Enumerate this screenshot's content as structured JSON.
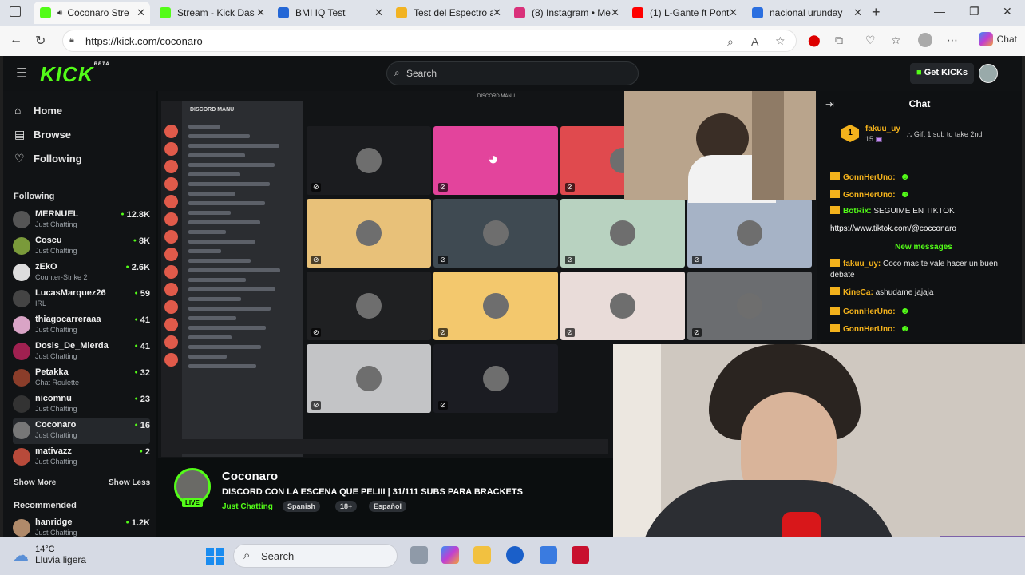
{
  "browser": {
    "tabs": [
      {
        "title": "Coconaro Stre",
        "icon": "kick-icon",
        "color": "#53fc18",
        "active": true
      },
      {
        "title": "Stream - Kick Das",
        "icon": "kick-icon",
        "color": "#53fc18"
      },
      {
        "title": "BMI IQ Test",
        "icon": "iq-icon",
        "color": "#2467d6"
      },
      {
        "title": "Test del Espectro a",
        "icon": "spectrum-icon",
        "color": "#f2b322"
      },
      {
        "title": "(8) Instagram • Me",
        "icon": "instagram-icon",
        "color": "#d9317a"
      },
      {
        "title": "(1) L-Gante ft Pont",
        "icon": "youtube-icon",
        "color": "#ff0000"
      },
      {
        "title": "nacional urunday",
        "icon": "search-icon",
        "color": "#2b6fe0"
      }
    ],
    "url": "https://kick.com/coconaro",
    "chat_label": "Chat"
  },
  "kick": {
    "logo": "KICK",
    "logo_sup": "BETA",
    "search_placeholder": "Search",
    "get_kicks": "Get KICKs",
    "nav": [
      {
        "label": "Home",
        "icon": "home-icon"
      },
      {
        "label": "Browse",
        "icon": "browse-icon"
      },
      {
        "label": "Following",
        "icon": "heart-icon"
      }
    ],
    "following_heading": "Following",
    "following": [
      {
        "name": "MERNUEL",
        "category": "Just Chatting",
        "viewers": "12.8K",
        "color": "#555"
      },
      {
        "name": "Coscu",
        "category": "Just Chatting",
        "viewers": "8K",
        "color": "#7a9a3a"
      },
      {
        "name": "zEkO",
        "category": "Counter-Strike 2",
        "viewers": "2.6K",
        "color": "#ddd"
      },
      {
        "name": "LucasMarquez26",
        "category": "IRL",
        "viewers": "59",
        "color": "#444"
      },
      {
        "name": "thiagocarreraaa",
        "category": "Just Chatting",
        "viewers": "41",
        "color": "#d9a4c6"
      },
      {
        "name": "Dosis_De_Mierda",
        "category": "Just Chatting",
        "viewers": "41",
        "color": "#a02050"
      },
      {
        "name": "Petakka",
        "category": "Chat Roulette",
        "viewers": "32",
        "color": "#8a3d2a"
      },
      {
        "name": "nicomnu",
        "category": "Just Chatting",
        "viewers": "23",
        "color": "#333"
      },
      {
        "name": "Coconaro",
        "category": "Just Chatting",
        "viewers": "16",
        "color": "#777",
        "selected": true
      },
      {
        "name": "mativazz",
        "category": "Just Chatting",
        "viewers": "2",
        "color": "#b84a3a"
      }
    ],
    "show_more": "Show More",
    "show_less": "Show Less",
    "recommended_heading": "Recommended",
    "recommended": [
      {
        "name": "hanridge",
        "category": "Just Chatting",
        "viewers": "1.2K",
        "color": "#b08a6a"
      }
    ]
  },
  "stream": {
    "discord_title": "DISCORD MANU",
    "discord_header": "DISCORD MANU",
    "tiles": [
      {
        "bg": "#1b1c1f"
      },
      {
        "bg": "#e3449c",
        "discord": true
      },
      {
        "bg": "#e04a4e"
      },
      {
        "bg": "#e8c179"
      },
      {
        "bg": "#3f4a52"
      },
      {
        "bg": "#b8d2c0"
      },
      {
        "bg": "#a6b3c6"
      },
      {
        "bg": "#1f2022"
      },
      {
        "bg": "#f3c86d"
      },
      {
        "bg": "#e9dcd9"
      },
      {
        "bg": "#6b6d70"
      },
      {
        "bg": "#c3c4c6"
      },
      {
        "bg": "#1b1c22"
      },
      {
        "bg": "#aeb6c8"
      }
    ],
    "streamer_name": "Coconaro",
    "stream_title": "DISCORD CON LA ESCENA QUE PELIII | 31/111 SUBS PARA BRACKETS",
    "category": "Just Chatting",
    "live_label": "LIVE",
    "tags": [
      "Spanish",
      "18+",
      "Español"
    ]
  },
  "chat": {
    "title": "Chat",
    "pinned_user": "fakuu_uy",
    "pinned_count": "15",
    "pinned_level": "1",
    "pinned_text": "Gift 1 sub to take 2nd",
    "messages": [
      {
        "user": "GonnHerUno",
        "text": "",
        "color": "#f3b21c"
      },
      {
        "user": "GonnHerUno",
        "text": "",
        "color": "#f3b21c"
      },
      {
        "user": "BotRix",
        "text": "SEGUIME EN TIKTOK",
        "color": "#53fc18"
      },
      {
        "link": "https://www.tiktok.com/@cocconaro"
      }
    ],
    "new_messages": "New messages",
    "messages_after": [
      {
        "user": "fakuu_uy",
        "text": "Coco mas te vale hacer un buen debate",
        "color": "#f3b21c"
      },
      {
        "user": "KineCa",
        "text": "ashudame jajaja",
        "color": "#f3b21c"
      },
      {
        "user": "GonnHerUno",
        "text": "",
        "color": "#f3b21c"
      },
      {
        "user": "GonnHerUno",
        "text": "",
        "color": "#f3b21c"
      }
    ]
  },
  "taskbar": {
    "temp": "14°C",
    "weather": "Lluvia ligera",
    "search_placeholder": "Search"
  }
}
